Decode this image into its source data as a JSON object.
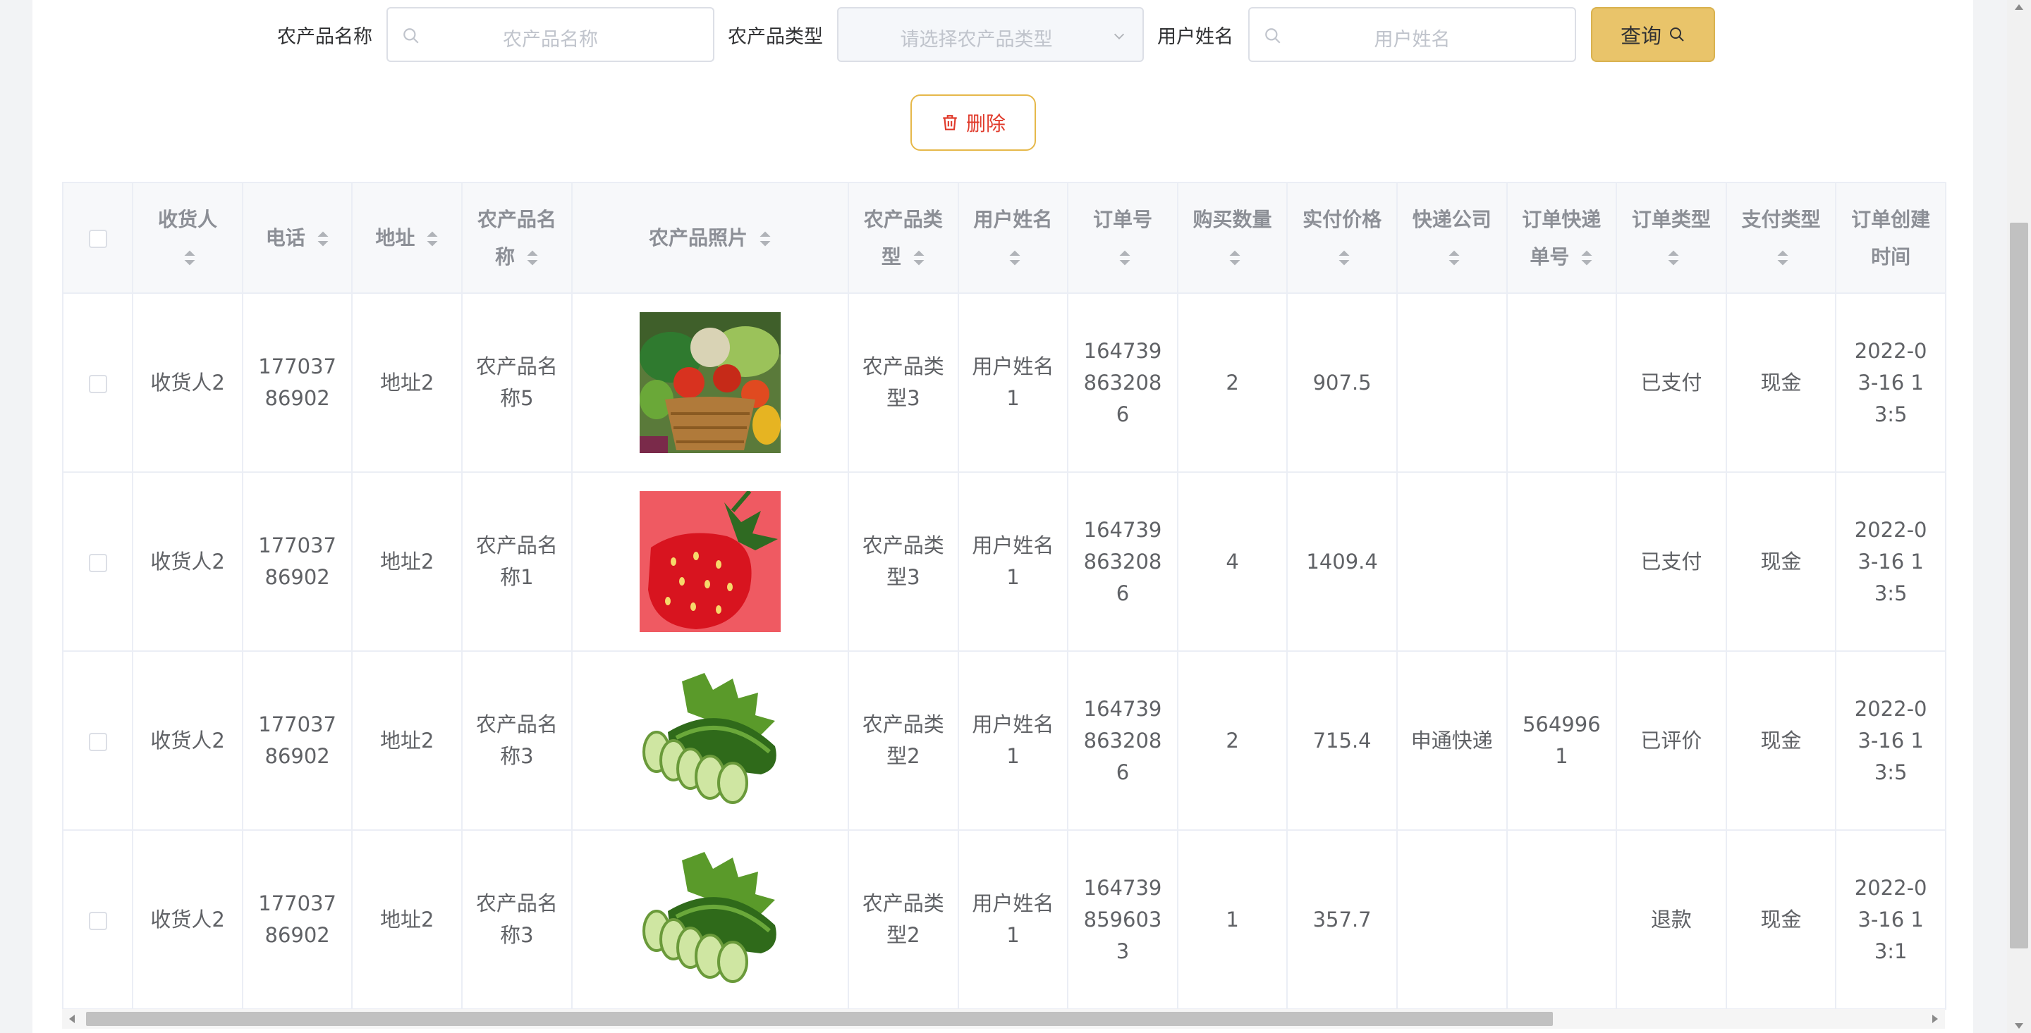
{
  "search": {
    "product_name_label": "农产品名称",
    "product_name_placeholder": "农产品名称",
    "product_type_label": "农产品类型",
    "product_type_placeholder": "请选择农产品类型",
    "user_name_label": "用户姓名",
    "user_name_placeholder": "用户姓名",
    "query_label": "查询"
  },
  "actions": {
    "delete_label": "删除"
  },
  "table": {
    "headers": {
      "recipient": "收货人",
      "phone": "电话",
      "address": "地址",
      "product_name": "农产品名称",
      "photo": "农产品照片",
      "product_type": "农产品类型",
      "user_name": "用户姓名",
      "order_no": "订单号",
      "quantity": "购买数量",
      "paid_price": "实付价格",
      "courier": "快递公司",
      "tracking_no": "订单快递单号",
      "order_type": "订单类型",
      "payment_type": "支付类型",
      "order_time": "订单创建时间"
    },
    "rows": [
      {
        "recipient": "收货人2",
        "phone": "17703786902",
        "address": "地址2",
        "product_name": "农产品名称5",
        "photo": "vegetable-basket",
        "product_type": "农产品类型3",
        "user_name": "用户姓名1",
        "order_no": "1647398632086",
        "quantity": "2",
        "paid_price": "907.5",
        "courier": "",
        "tracking_no": "",
        "order_type": "已支付",
        "payment_type": "现金",
        "order_time": "2022-03-16 1​3:5"
      },
      {
        "recipient": "收货人2",
        "phone": "17703786902",
        "address": "地址2",
        "product_name": "农产品名称1",
        "photo": "strawberry",
        "product_type": "农产品类型3",
        "user_name": "用户姓名1",
        "order_no": "1647398632086",
        "quantity": "4",
        "paid_price": "1409.4",
        "courier": "",
        "tracking_no": "",
        "order_type": "已支付",
        "payment_type": "现金",
        "order_time": "2022-03-16 1​3:5"
      },
      {
        "recipient": "收货人2",
        "phone": "17703786902",
        "address": "地址2",
        "product_name": "农产品名称3",
        "photo": "cucumber",
        "product_type": "农产品类型2",
        "user_name": "用户姓名1",
        "order_no": "1647398632086",
        "quantity": "2",
        "paid_price": "715.4",
        "courier": "申通快递",
        "tracking_no": "5649961",
        "order_type": "已评价",
        "payment_type": "现金",
        "order_time": "2022-03-16 1​3:5"
      },
      {
        "recipient": "收货人2",
        "phone": "17703786902",
        "address": "地址2",
        "product_name": "农产品名称3",
        "photo": "cucumber",
        "product_type": "农产品类型2",
        "user_name": "用户姓名1",
        "order_no": "1647398596033",
        "quantity": "1",
        "paid_price": "357.7",
        "courier": "",
        "tracking_no": "",
        "order_type": "退款",
        "payment_type": "现金",
        "order_time": "2022-03-16 1​3:1"
      }
    ]
  },
  "colors": {
    "accent": "#e9c46a",
    "danger": "#e03a2b",
    "header_bg": "#f7f8fa"
  }
}
